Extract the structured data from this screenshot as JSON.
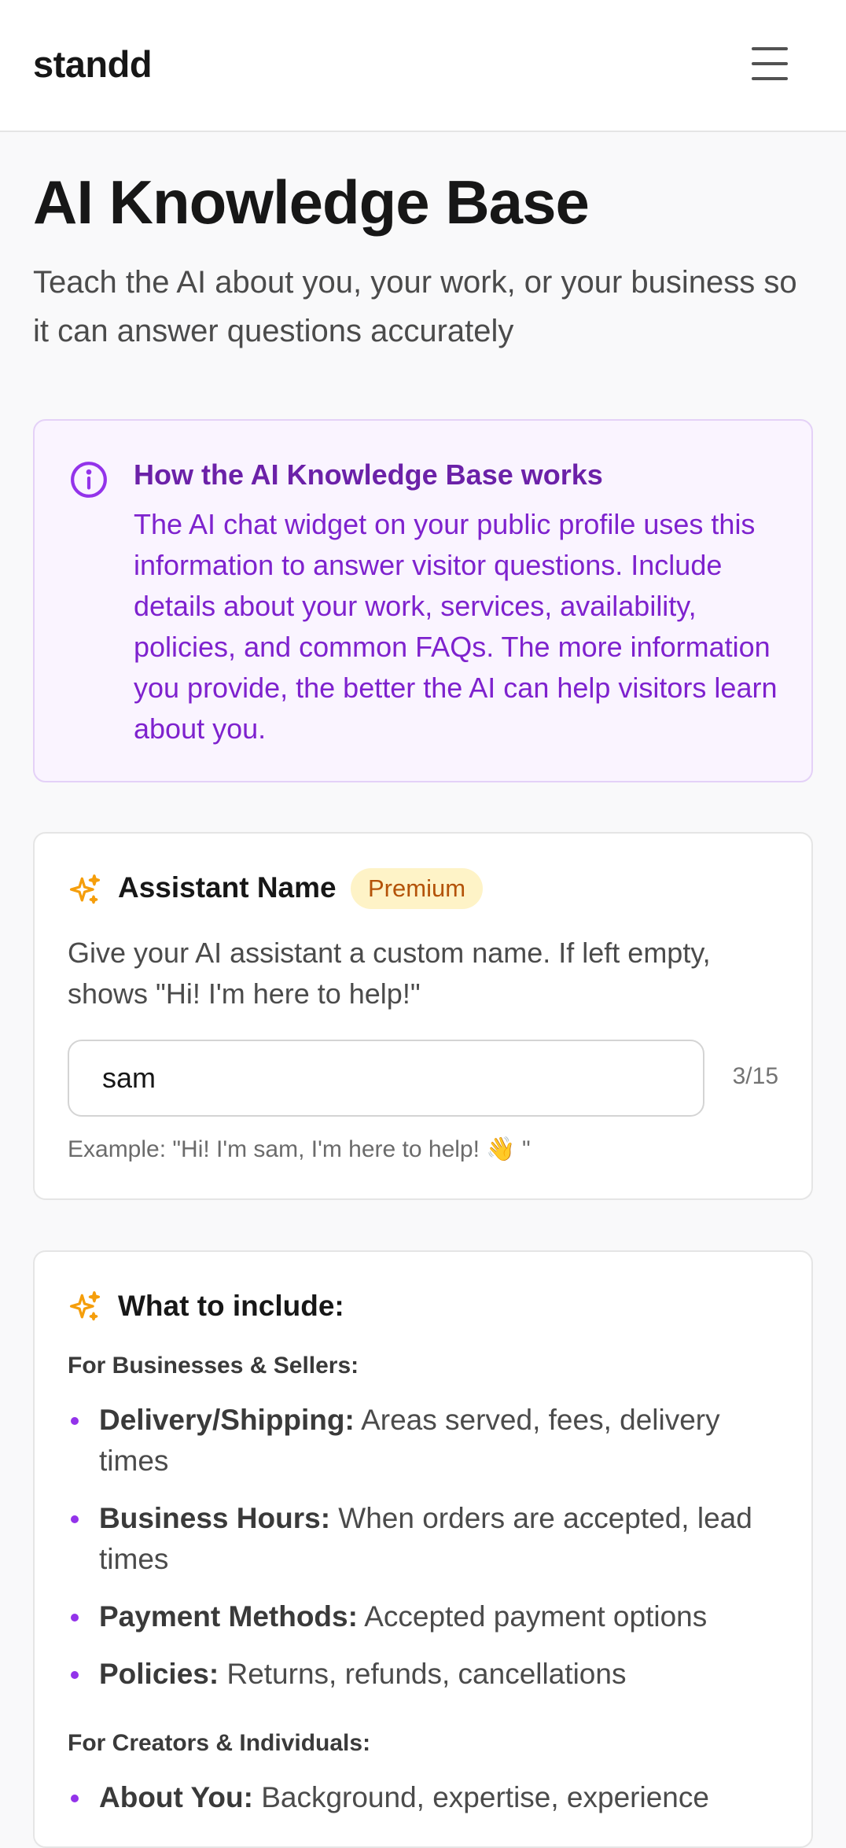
{
  "header": {
    "logo": "standd",
    "menu_icon": "hamburger-menu-icon"
  },
  "page": {
    "title": "AI Knowledge Base",
    "subtitle": "Teach the AI about you, your work, or your business so it can answer questions accurately"
  },
  "info": {
    "icon": "info-circle-icon",
    "title": "How the AI Knowledge Base works",
    "text": "The AI chat widget on your public profile uses this information to answer visitor questions. Include details about your work, services, availability, policies, and common FAQs. The more information you provide, the better the AI can help visitors learn about you."
  },
  "assistant": {
    "icon": "sparkles-icon",
    "title": "Assistant Name",
    "badge": "Premium",
    "description": "Give your AI assistant a custom name. If left empty, shows \"Hi! I'm here to help!\"",
    "input_value": "sam",
    "counter": "3/15",
    "example": "Example: \"Hi! I'm sam, I'm here to help! 👋 \""
  },
  "include": {
    "icon": "sparkles-icon",
    "title": "What to include:",
    "sections": [
      {
        "label": "For Businesses & Sellers:",
        "items": [
          {
            "term": "Delivery/Shipping:",
            "desc": "Areas served, fees, delivery times"
          },
          {
            "term": "Business Hours:",
            "desc": "When orders are accepted, lead times"
          },
          {
            "term": "Payment Methods:",
            "desc": "Accepted payment options"
          },
          {
            "term": "Policies:",
            "desc": "Returns, refunds, cancellations"
          }
        ]
      },
      {
        "label": "For Creators & Individuals:",
        "items": [
          {
            "term": "About You:",
            "desc": "Background, expertise, experience"
          }
        ]
      }
    ]
  },
  "colors": {
    "accent_purple": "#7e22ce",
    "sparkle_orange": "#f59e0b",
    "badge_bg": "#fef3c7",
    "badge_text": "#b45309"
  }
}
